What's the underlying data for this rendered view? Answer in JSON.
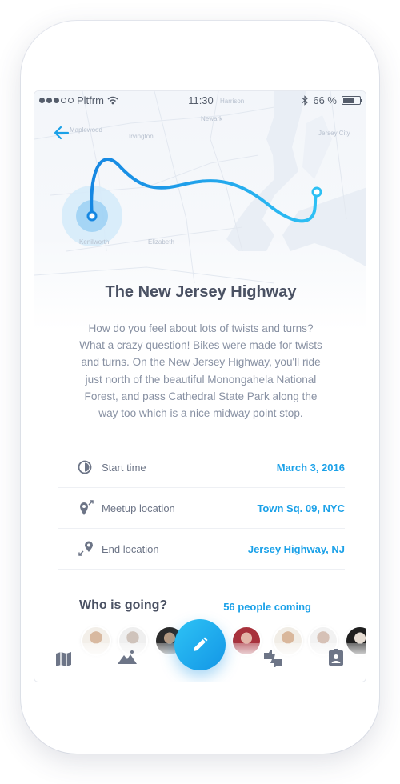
{
  "status_bar": {
    "carrier": "Pltfrm",
    "time": "11:30",
    "battery": "66 %"
  },
  "map": {
    "labels": [
      "Harrison",
      "Newark",
      "Jersey City",
      "Maplewood",
      "Irvington",
      "Elizabeth",
      "Kenilworth"
    ]
  },
  "event": {
    "title": "The New Jersey Highway",
    "description": "How do you feel about lots of twists and turns? What a crazy question! Bikes were made for twists and turns. On the New Jersey Highway, you'll ride just north of the beautiful Monongahela National Forest, and pass Cathedral State Park along the way too which is a nice midway point stop."
  },
  "details": [
    {
      "icon": "clock-icon",
      "label": "Start time",
      "value": "March 3, 2016"
    },
    {
      "icon": "meetup-pin-icon",
      "label": "Meetup location",
      "value": "Town Sq. 09, NYC"
    },
    {
      "icon": "end-pin-icon",
      "label": "End location",
      "value": "Jersey Highway, NJ"
    }
  ],
  "going": {
    "title": "Who is going?",
    "count": "56 people coming"
  },
  "tabs": [
    {
      "icon": "map-icon"
    },
    {
      "icon": "mountains-icon"
    },
    {
      "icon": "edit-icon"
    },
    {
      "icon": "thumbs-icon"
    },
    {
      "icon": "contact-card-icon"
    }
  ],
  "colors": {
    "accent": "#1ba1e8",
    "title": "#4a5163",
    "body": "#8891a3"
  }
}
